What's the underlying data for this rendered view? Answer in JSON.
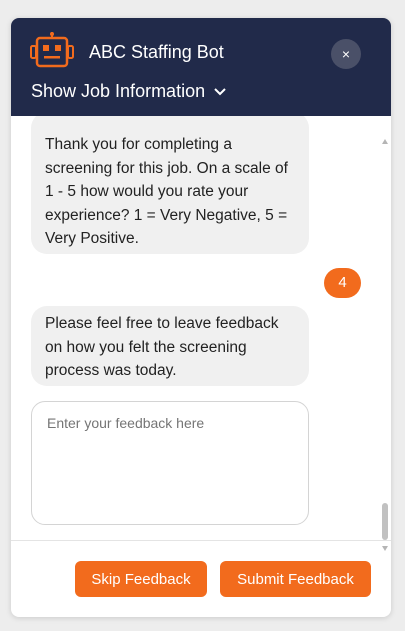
{
  "header": {
    "title": "ABC Staffing Bot",
    "close_glyph": "×",
    "job_toggle_label": "Show Job Information",
    "bot_icon": "robot-icon",
    "colors": {
      "header_bg": "#212a4a",
      "accent": "#f26b1d"
    }
  },
  "chat": {
    "messages": [
      {
        "from": "bot",
        "text": "Thank you for completing a screening for this job. On a scale of 1 - 5 how would you rate your experience? 1 = Very Negative, 5 = Very Positive."
      },
      {
        "from": "user",
        "text": "4"
      },
      {
        "from": "bot",
        "text": "Please feel free to leave feedback on how you felt the screening process was today."
      }
    ],
    "feedback_placeholder": "Enter your feedback here"
  },
  "footer": {
    "skip_label": "Skip Feedback",
    "submit_label": "Submit Feedback"
  }
}
